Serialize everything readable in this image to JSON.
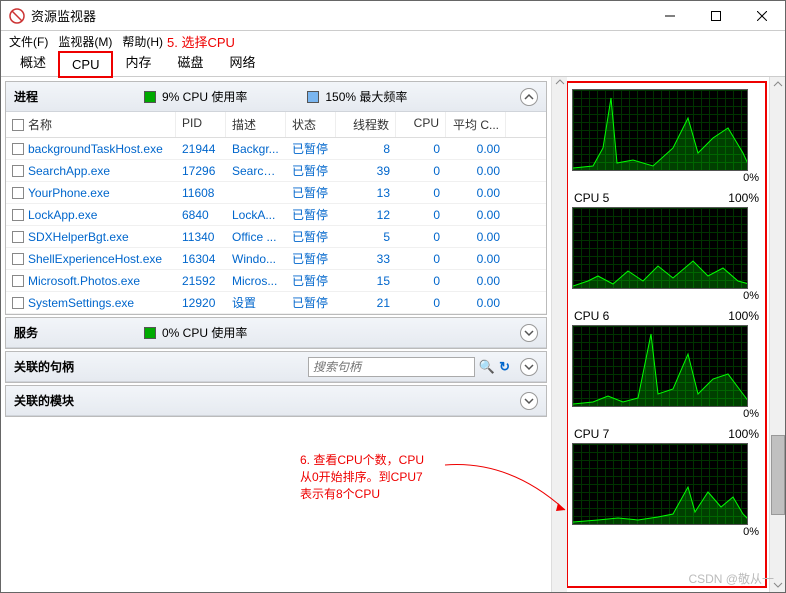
{
  "window": {
    "title": "资源监视器"
  },
  "titlebar_buttons": {
    "min": "minimize",
    "max": "maximize",
    "close": "close"
  },
  "menu": {
    "file": "文件(F)",
    "monitor": "监视器(M)",
    "help": "帮助(H)"
  },
  "annotation5": "5. 选择CPU",
  "tabs": {
    "overview": "概述",
    "cpu": "CPU",
    "memory": "内存",
    "disk": "磁盘",
    "network": "网络"
  },
  "panels": {
    "processes": {
      "title": "进程",
      "metric1": "9% CPU 使用率",
      "metric2": "150% 最大频率"
    },
    "services": {
      "title": "服务",
      "metric1": "0% CPU 使用率"
    },
    "handles": {
      "title": "关联的句柄",
      "search_placeholder": "搜索句柄"
    },
    "modules": {
      "title": "关联的模块"
    }
  },
  "columns": {
    "name": "名称",
    "pid": "PID",
    "desc": "描述",
    "status": "状态",
    "threads": "线程数",
    "cpu": "CPU",
    "avg": "平均 C..."
  },
  "rows": [
    {
      "name": "backgroundTaskHost.exe",
      "pid": "21944",
      "desc": "Backgr...",
      "status": "已暂停",
      "threads": "8",
      "cpu": "0",
      "avg": "0.00"
    },
    {
      "name": "SearchApp.exe",
      "pid": "17296",
      "desc": "Search...",
      "status": "已暂停",
      "threads": "39",
      "cpu": "0",
      "avg": "0.00"
    },
    {
      "name": "YourPhone.exe",
      "pid": "11608",
      "desc": "",
      "status": "已暂停",
      "threads": "13",
      "cpu": "0",
      "avg": "0.00"
    },
    {
      "name": "LockApp.exe",
      "pid": "6840",
      "desc": "LockA...",
      "status": "已暂停",
      "threads": "12",
      "cpu": "0",
      "avg": "0.00"
    },
    {
      "name": "SDXHelperBgt.exe",
      "pid": "11340",
      "desc": "Office ...",
      "status": "已暂停",
      "threads": "5",
      "cpu": "0",
      "avg": "0.00"
    },
    {
      "name": "ShellExperienceHost.exe",
      "pid": "16304",
      "desc": "Windo...",
      "status": "已暂停",
      "threads": "33",
      "cpu": "0",
      "avg": "0.00"
    },
    {
      "name": "Microsoft.Photos.exe",
      "pid": "21592",
      "desc": "Micros...",
      "status": "已暂停",
      "threads": "15",
      "cpu": "0",
      "avg": "0.00"
    },
    {
      "name": "SystemSettings.exe",
      "pid": "12920",
      "desc": "设置",
      "status": "已暂停",
      "threads": "21",
      "cpu": "0",
      "avg": "0.00"
    }
  ],
  "graphs": [
    {
      "label": "",
      "max": "",
      "pct": "0%"
    },
    {
      "label": "CPU 5",
      "max": "100%",
      "pct": "0%"
    },
    {
      "label": "CPU 6",
      "max": "100%",
      "pct": "0%"
    },
    {
      "label": "CPU 7",
      "max": "100%",
      "pct": "0%"
    }
  ],
  "graph_paths": [
    "M0,80 L20,78 L30,60 L38,10 L44,75 L60,72 L80,78 L100,60 L115,30 L125,65 L140,50 L155,40 L170,65 L176,78",
    "M0,80 L15,75 L25,70 L40,78 L55,65 L70,75 L85,60 L100,72 L120,55 L135,70 L150,62 L165,75 L176,78",
    "M0,80 L20,78 L35,72 L50,78 L65,74 L78,10 L85,70 L100,65 L115,30 L125,70 L140,55 L155,50 L170,70 L176,78",
    "M0,80 L25,78 L45,76 L65,78 L85,75 L100,72 L115,45 L122,70 L135,50 L148,65 L160,55 L170,72 L176,78"
  ],
  "annotation6": {
    "l1": "6. 查看CPU个数，CPU",
    "l2": "从0开始排序。到CPU7",
    "l3": "表示有8个CPU"
  },
  "watermark": "CSDN @敬从一"
}
